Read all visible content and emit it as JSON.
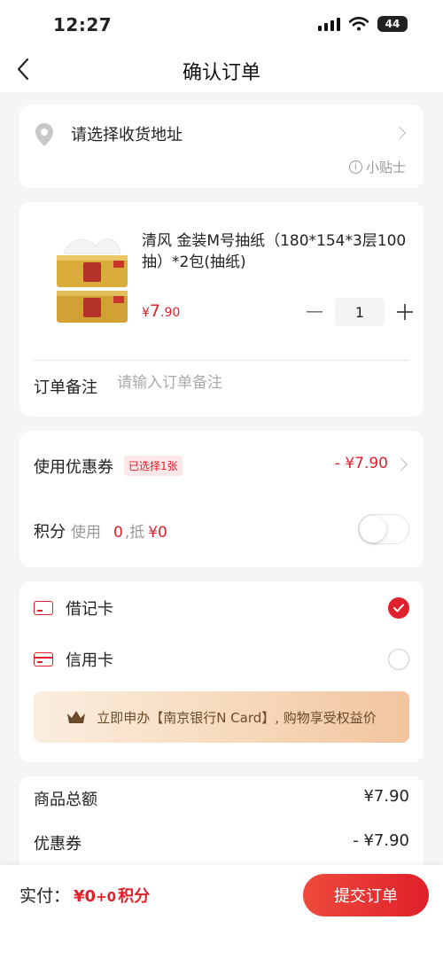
{
  "status_bar": {
    "time": "12:27",
    "battery": "44"
  },
  "nav": {
    "title": "确认订单"
  },
  "address": {
    "placeholder": "请选择收货地址",
    "tip": "小贴士"
  },
  "product": {
    "name": "清风 金装M号抽纸（180*154*3层100抽）*2包(抽纸)",
    "price_currency": "¥",
    "price_integer": "7",
    "price_decimal": ".90",
    "quantity": "1",
    "image_icon": "tissue-pack-image"
  },
  "remark": {
    "label": "订单备注",
    "placeholder": "请输入订单备注"
  },
  "coupon": {
    "label": "使用优惠券",
    "badge": "已选择1张",
    "amount": "- ¥7.90"
  },
  "points": {
    "label": "积分",
    "use": "使用",
    "value": "0",
    "off": ",抵",
    "money": "¥0",
    "enabled": false
  },
  "payment": {
    "options": [
      {
        "label": "借记卡",
        "selected": true
      },
      {
        "label": "信用卡",
        "selected": false
      }
    ],
    "promo": "立即申办【南京银行N Card】, 购物享受权益价"
  },
  "summary": {
    "rows": [
      {
        "label": "商品总额",
        "value": "¥7.90"
      },
      {
        "label": "优惠券",
        "value": "- ¥7.90"
      }
    ]
  },
  "bottom": {
    "actual_label": "实付：",
    "actual_amount": "¥0",
    "actual_plus": "+0",
    "actual_points": "积分",
    "submit": "提交订单"
  },
  "colors": {
    "accent": "#e0202b",
    "background": "#f5f5f5",
    "promo_text": "#6b4a2a"
  }
}
